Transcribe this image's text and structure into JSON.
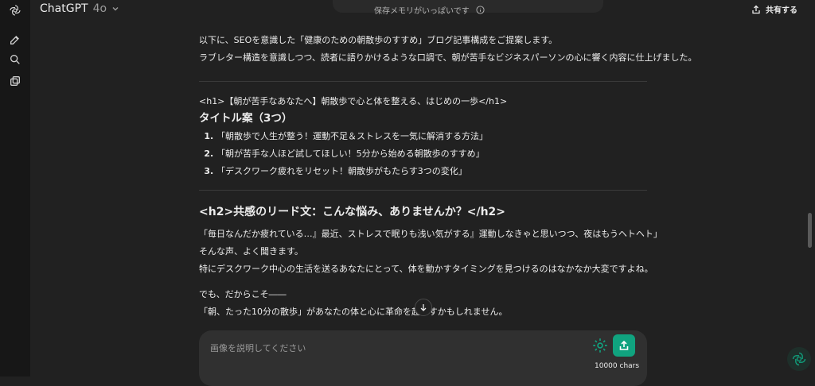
{
  "header": {
    "model_name": "ChatGPT",
    "model_version": "4o",
    "memory_notice": "保存メモリがいっぱいです",
    "share_label": "共有する"
  },
  "message": {
    "intro1": "以下に、SEOを意識した「健康のための朝散歩のすすめ」ブログ記事構成をご提案します。",
    "intro2": "ラブレター構造を意識しつつ、読者に語りかけるような口調で、朝が苦手なビジネスパーソンの心に響く内容に仕上げました。",
    "h1_line": "<h1>【朝が苦手なあなたへ】朝散歩で心と体を整える、はじめの一歩</h1>",
    "titles_heading": "タイトル案（3つ）",
    "titles": [
      "「朝散歩で人生が整う！運動不足＆ストレスを一気に解消する方法」",
      "「朝が苦手な人ほど試してほしい！5分から始める朝散歩のすすめ」",
      "「デスクワーク疲れをリセット！朝散歩がもたらす3つの変化」"
    ],
    "h2_heading": "<h2>共感のリード文：こんな悩み、ありませんか？</h2>",
    "lead1": "「毎日なんだか疲れている…』最近、ストレスで眠りも浅い気がする』運動しなきゃと思いつつ、夜はもうヘトヘト」",
    "lead2": "そんな声、よく聞きます。",
    "lead3": "特にデスクワーク中心の生活を送るあなたにとって、体を動かすタイミングを見つけるのはなかなか大変ですよね。",
    "lead4": "でも、だからこそ――",
    "lead5": "「朝、たった10分の散歩」があなたの体と心に革命を起こすかもしれません。"
  },
  "composer": {
    "placeholder": "画像を説明してください",
    "char_count": "10000 chars"
  },
  "icons": {
    "logo": "openai-logo-icon",
    "new_chat": "edit-icon",
    "search": "search-icon",
    "library": "library-icon",
    "share": "share-icon",
    "info": "info-icon",
    "scroll_down": "arrow-down-icon",
    "gear": "gear-icon",
    "send": "upload-icon"
  },
  "colors": {
    "background": "#212121",
    "sidebar": "#171717",
    "accent": "#10a37f"
  }
}
